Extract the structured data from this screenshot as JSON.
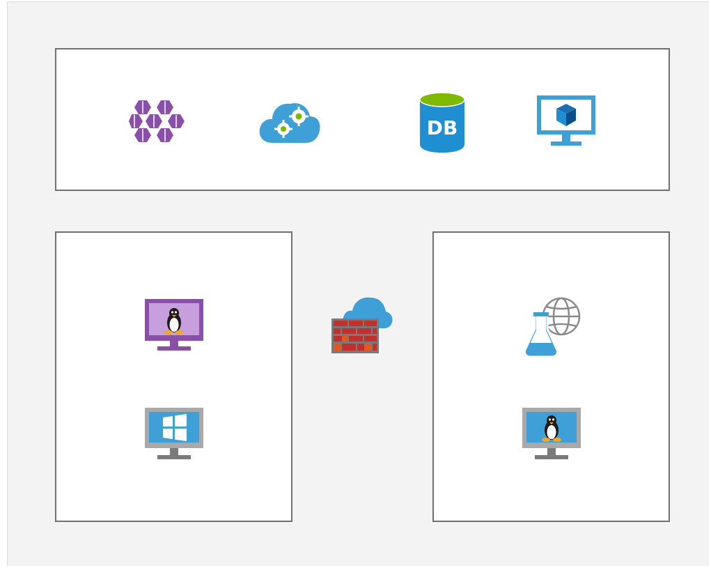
{
  "icons": {
    "top": [
      {
        "name": "container-registry-icon",
        "color": "#8a4fa8"
      },
      {
        "name": "cloud-service-icon",
        "color": "#3fa0d8"
      },
      {
        "name": "sql-database-icon",
        "color": "#1f8fd1",
        "label": "DB"
      },
      {
        "name": "virtual-machine-icon",
        "color": "#3fa0d8"
      }
    ],
    "left": [
      {
        "name": "linux-vm-purple-icon",
        "color": "#8a4fa8"
      },
      {
        "name": "windows-vm-icon",
        "color": "#3fa0d8"
      }
    ],
    "center": {
      "name": "cloud-firewall-icon",
      "color": "#c0312d"
    },
    "right": [
      {
        "name": "web-test-lab-icon",
        "color": "#3fa0d8"
      },
      {
        "name": "linux-vm-blue-icon",
        "color": "#3fa0d8"
      }
    ]
  }
}
